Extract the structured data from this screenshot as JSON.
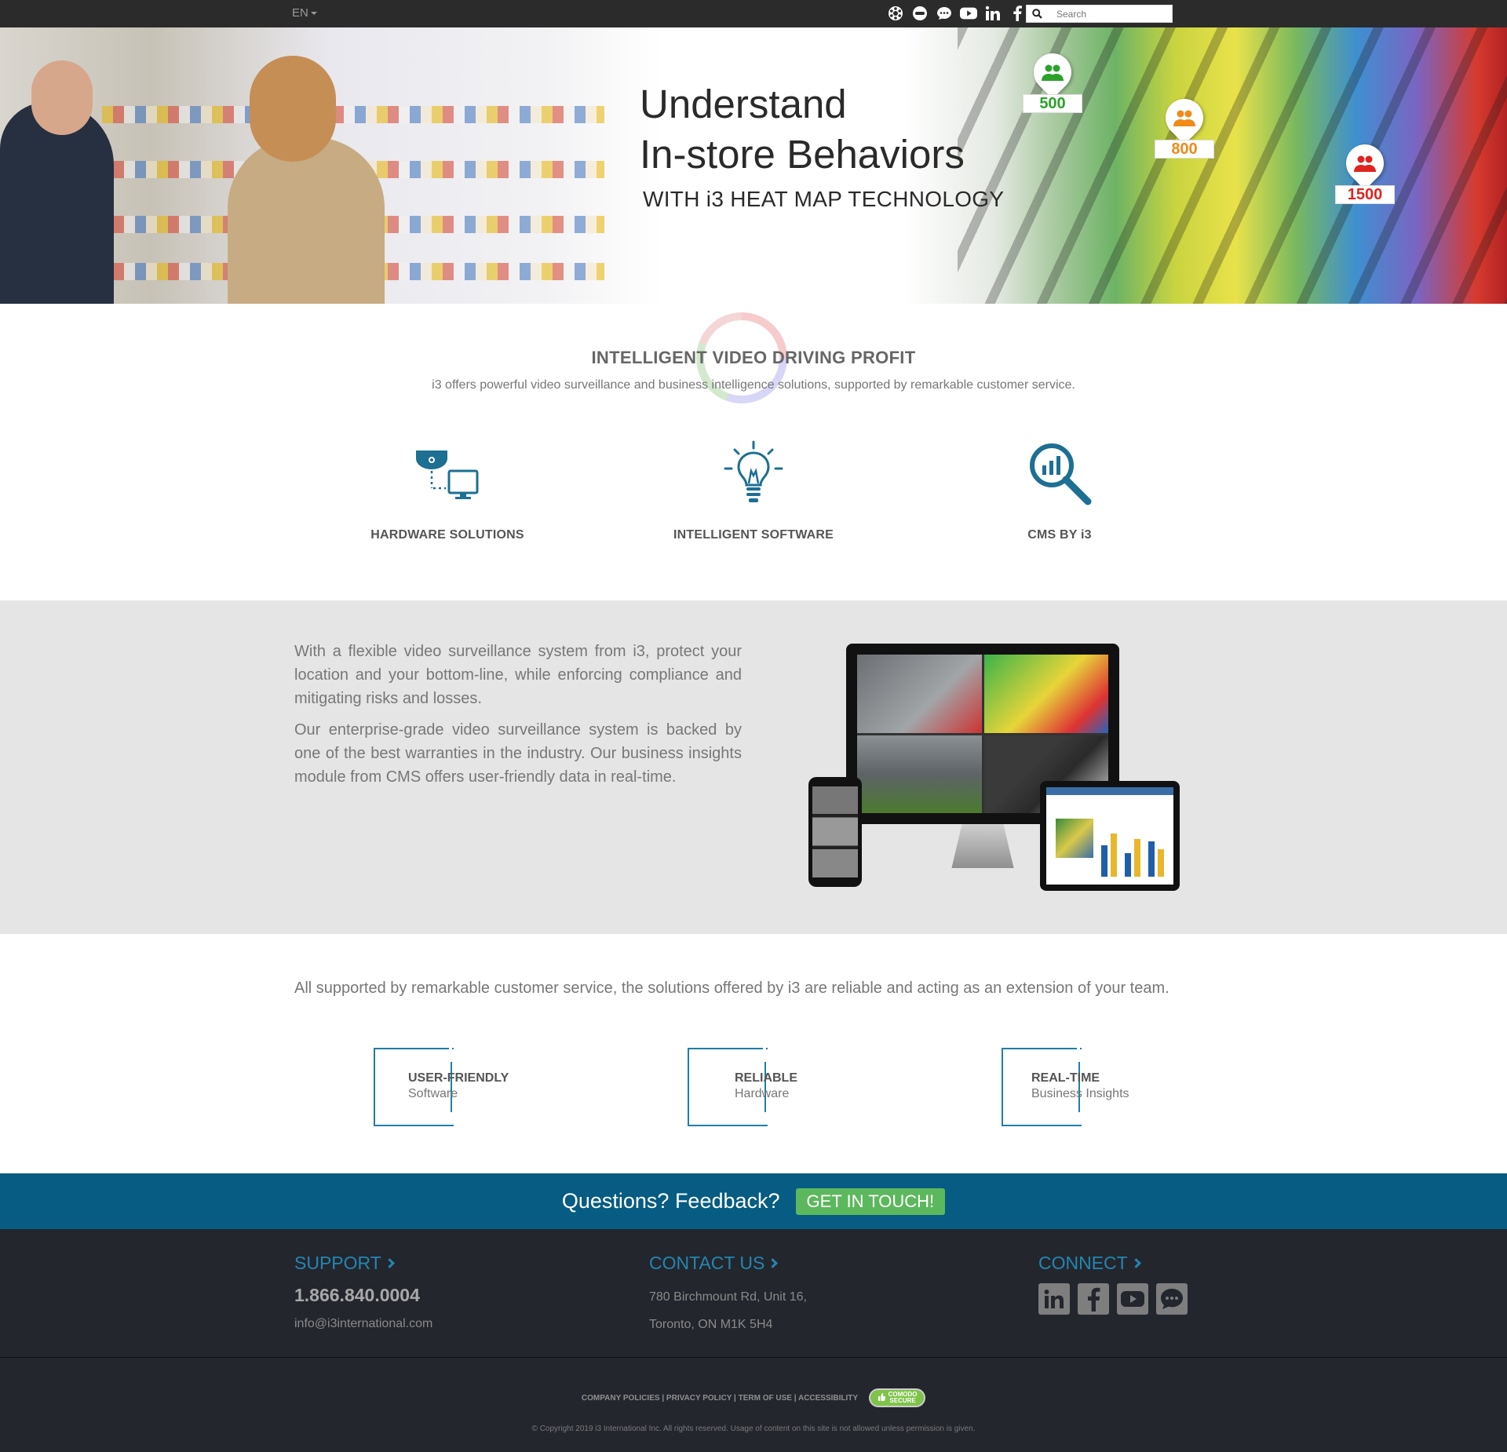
{
  "topbar": {
    "language": "EN",
    "social_icons": [
      "hub-icon",
      "chat-bubble-icon",
      "comment-icon",
      "youtube-icon",
      "linkedin-icon",
      "facebook-icon"
    ],
    "search_placeholder": "Search"
  },
  "hero": {
    "title_line1": "Understand",
    "title_line2": "In-store Behaviors",
    "subtitle": "WITH i3 HEAT MAP TECHNOLOGY",
    "pins": [
      {
        "count": "500",
        "color": "#2aa22a"
      },
      {
        "count": "800",
        "color": "#f08a19"
      },
      {
        "count": "1500",
        "color": "#e0241f"
      }
    ],
    "slides": 4,
    "active_slide": 4
  },
  "intro": {
    "title": "INTELLIGENT VIDEO DRIVING PROFIT",
    "subtitle": "i3 offers powerful video surveillance and business intelligence solutions, supported by remarkable customer service."
  },
  "features": [
    {
      "label": "HARDWARE SOLUTIONS",
      "icon": "camera-monitor-icon"
    },
    {
      "label": "INTELLIGENT SOFTWARE",
      "icon": "lightbulb-icon"
    },
    {
      "label": "CMS BY i3",
      "icon": "chart-magnifier-icon"
    }
  ],
  "band": {
    "paragraph1": "With a flexible video surveillance system from i3, protect your location and your bottom-line, while enforcing compliance and mitigating risks and losses.",
    "paragraph2": "Our enterprise-grade video surveillance system is backed by one of the best warranties in the industry. Our business insights module from CMS offers user-friendly data in real-time."
  },
  "support": {
    "text": "All supported by remarkable customer service, the solutions offered by i3 are reliable and acting as an extension of your team.",
    "badges": [
      {
        "title": "USER-FRIENDLY",
        "sub": "Software"
      },
      {
        "title": "RELIABLE",
        "sub": "Hardware"
      },
      {
        "title": "REAL-TIME",
        "sub": "Business Insights"
      }
    ]
  },
  "cta": {
    "question": "Questions? Feedback?",
    "button": "GET IN TOUCH!"
  },
  "footer": {
    "support_heading": "SUPPORT",
    "phone": "1.866.840.0004",
    "email": "info@i3international.com",
    "contact_heading": "CONTACT US",
    "address_line1": "780 Birchmount Rd, Unit 16,",
    "address_line2": "Toronto, ON M1K 5H4",
    "connect_heading": "CONNECT",
    "connect_icons": [
      "linkedin-icon",
      "facebook-icon",
      "youtube-icon",
      "chat-icon"
    ],
    "links": [
      "COMPANY POLICIES",
      "PRIVACY POLICY",
      "TERM OF USE",
      "ACCESSIBILITY"
    ],
    "comodo_line1": "COMODO",
    "comodo_line2": "SECURE",
    "copyright": "© Copyright 2019 i3 International Inc. All rights reserved. Usage of content on this site is not allowed unless permission is given."
  }
}
